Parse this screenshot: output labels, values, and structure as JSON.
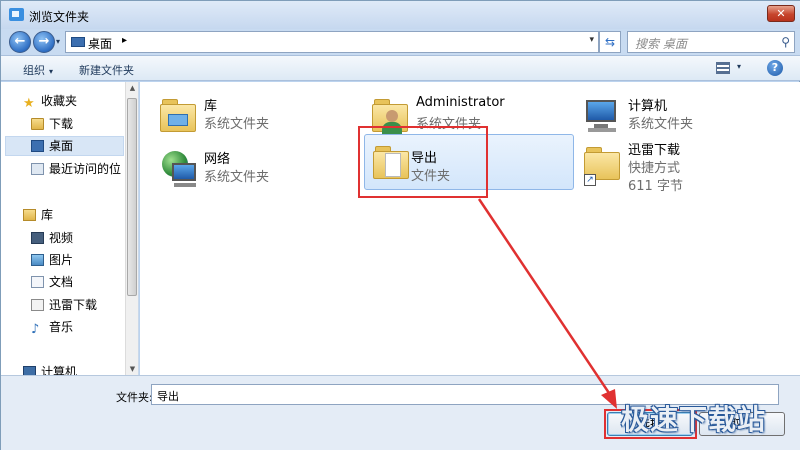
{
  "window": {
    "title": "浏览文件夹",
    "close_glyph": "✕"
  },
  "nav": {
    "back_glyph": "←",
    "forward_glyph": "→",
    "dropdown_glyph": "▾",
    "address": {
      "icon": "desktop-icon",
      "text": "桌面",
      "arrow": "▸",
      "drop": "▾"
    },
    "refresh_glyph": "⇆",
    "search": {
      "placeholder": "搜索 桌面",
      "icon": "search-icon",
      "glyph": "⚲"
    }
  },
  "toolbar": {
    "organize_label": "组织",
    "organize_caret": "▾",
    "new_folder_label": "新建文件夹",
    "view_caret": "▾",
    "help_glyph": "?"
  },
  "sidebar": {
    "items": [
      {
        "label": "收藏夹",
        "icon": "star-icon",
        "glyph": "★"
      },
      {
        "label": "下载",
        "icon": "download-folder-icon"
      },
      {
        "label": "桌面",
        "icon": "desktop-icon",
        "selected": true
      },
      {
        "label": "最近访问的位",
        "icon": "recent-icon"
      },
      {
        "label": "库",
        "icon": "library-icon"
      },
      {
        "label": "视频",
        "icon": "video-icon"
      },
      {
        "label": "图片",
        "icon": "picture-icon"
      },
      {
        "label": "文档",
        "icon": "document-icon"
      },
      {
        "label": "迅雷下载",
        "icon": "thunder-icon"
      },
      {
        "label": "音乐",
        "icon": "music-icon",
        "glyph": "♪"
      },
      {
        "label": "计算机",
        "icon": "computer-icon"
      }
    ],
    "scroll_up_glyph": "▲",
    "scroll_down_glyph": "▼"
  },
  "content": {
    "items": [
      {
        "name": "库",
        "sub": "系统文件夹",
        "icon": "library-icon"
      },
      {
        "name": "Administrator",
        "sub": "系统文件夹",
        "icon": "user-folder-icon"
      },
      {
        "name": "计算机",
        "sub": "系统文件夹",
        "icon": "computer-icon"
      },
      {
        "name": "网络",
        "sub": "系统文件夹",
        "icon": "network-icon"
      },
      {
        "name": "导出",
        "sub": "文件夹",
        "icon": "folder-icon",
        "selected": true
      },
      {
        "name": "迅雷下载",
        "sub": "快捷方式",
        "sub2": "611 字节",
        "icon": "shortcut-folder-icon"
      }
    ]
  },
  "bottom": {
    "folder_label": "文件夹:",
    "folder_value": "导出",
    "select_label": "选择",
    "cancel_label": "取消"
  },
  "watermark": "极速下载站",
  "colors": {
    "highlight": "#e03131",
    "accent": "#2f6fc4"
  }
}
